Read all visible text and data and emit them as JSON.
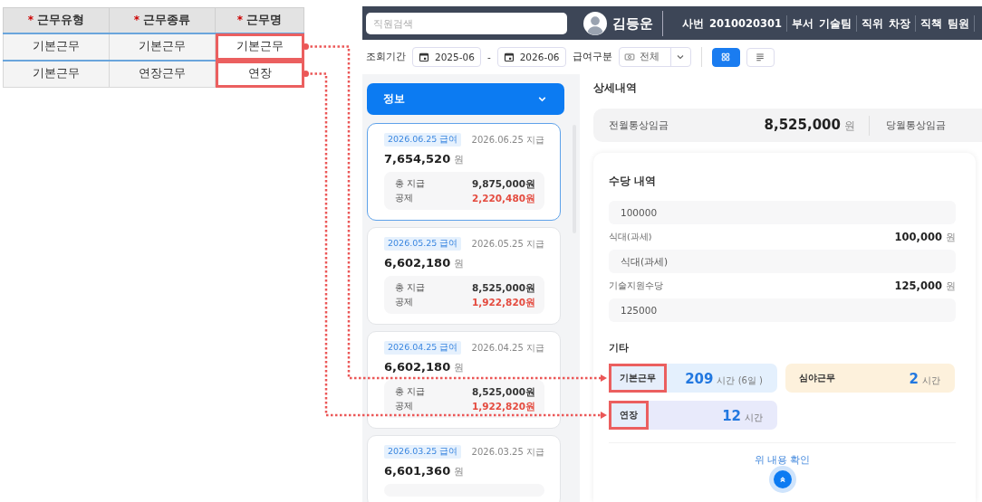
{
  "table": {
    "columns": [
      {
        "label": "근무유형",
        "mark": "*"
      },
      {
        "label": "근무종류",
        "mark": "*"
      },
      {
        "label": "근무명",
        "mark": "*"
      }
    ],
    "rows": [
      {
        "cells": [
          "기본근무",
          "기본근무",
          "기본근무"
        ],
        "linked": true
      },
      {
        "cells": [
          "기본근무",
          "연장근무",
          "연장"
        ],
        "linked": true
      }
    ]
  },
  "app": {
    "search": {
      "placeholder": "직원검색"
    },
    "profile": {
      "name": "김등운",
      "fields": [
        {
          "label": "사번",
          "value": "2010020301"
        },
        {
          "label": "부서",
          "value": "기술팀"
        },
        {
          "label": "직위",
          "value": "차장"
        },
        {
          "label": "직책",
          "value": "팀원"
        }
      ]
    },
    "filters": {
      "period_label": "조회기간",
      "from": "2025-06",
      "separator": "-",
      "to": "2026-06",
      "type_label": "급여구분",
      "type_value": "전체",
      "views": [
        {
          "kind": "grid",
          "selected": true
        },
        {
          "kind": "list",
          "selected": false
        }
      ]
    },
    "sidebar": {
      "header": "정보",
      "payslips": [
        {
          "tag": "2026.06.25 급여",
          "paid": "2026.06.25 지급",
          "amount": "7,654,520",
          "unit": "원",
          "gross_label": "총 지급",
          "gross": "9,875,000원",
          "deduction_label": "공제",
          "deduction": "2,220,480원",
          "selected": true
        },
        {
          "tag": "2026.05.25 급여",
          "paid": "2026.05.25 지급",
          "amount": "6,602,180",
          "unit": "원",
          "gross_label": "총 지급",
          "gross": "8,525,000원",
          "deduction_label": "공제",
          "deduction": "1,922,820원",
          "selected": false
        },
        {
          "tag": "2026.04.25 급여",
          "paid": "2026.04.25 지급",
          "amount": "6,602,180",
          "unit": "원",
          "gross_label": "총 지급",
          "gross": "8,525,000원",
          "deduction_label": "공제",
          "deduction": "1,922,820원",
          "selected": false
        },
        {
          "tag": "2026.03.25 급여",
          "paid": "2026.03.25 지급",
          "amount": "6,601,360",
          "unit": "원",
          "selected": false
        }
      ]
    },
    "detail": {
      "title": "상세내역",
      "prev_label": "전월통상임금",
      "prev_amount": "8,525,000",
      "unit": "원",
      "curr_label": "당월통상임금",
      "allowance": {
        "title": "수당 내역",
        "items": [
          {
            "kind": "field",
            "value": "100000"
          },
          {
            "kind": "row",
            "label": "식대(과세)",
            "amount": "100,000",
            "unit": "원"
          },
          {
            "kind": "field",
            "value": "식대(과세)"
          },
          {
            "kind": "row",
            "label": "기술지원수당",
            "amount": "125,000",
            "unit": "원"
          },
          {
            "kind": "field",
            "value": "125000"
          }
        ]
      },
      "other": {
        "title": "기타",
        "tiles": [
          {
            "label": "기본근무",
            "value": "209",
            "unit": "시간 (6일 )",
            "color": "#e4f0fd",
            "linked": true
          },
          {
            "label": "심야근무",
            "value": "2",
            "unit": "시간",
            "color": "#fdf1dc",
            "linked": false
          },
          {
            "label": "연장",
            "value": "12",
            "unit": "시간",
            "color": "#e8eafb",
            "linked": true
          }
        ]
      },
      "confirm_label": "위 내용 확인"
    }
  }
}
